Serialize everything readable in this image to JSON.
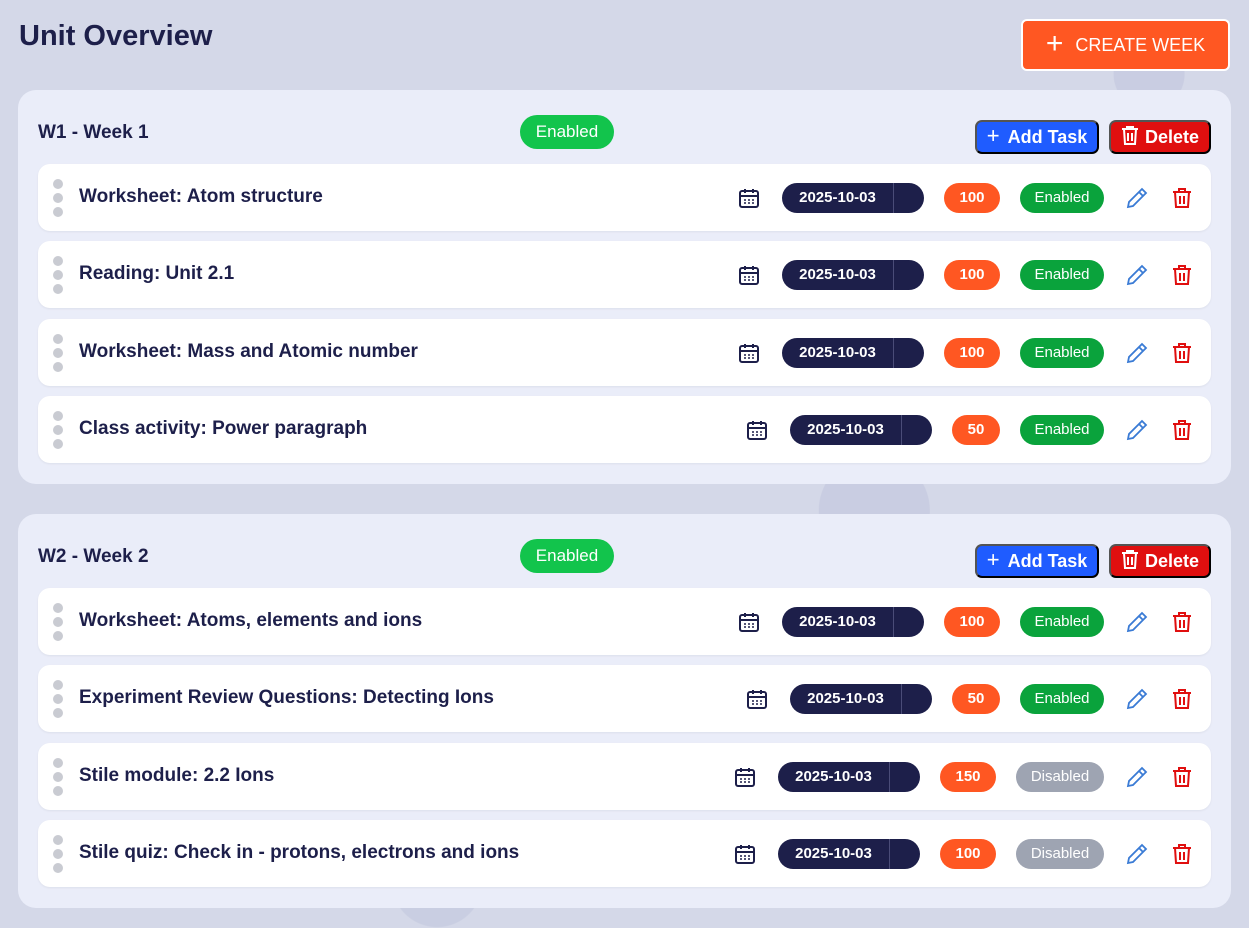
{
  "page": {
    "title": "Unit Overview",
    "create_week_label": "CREATE WEEK"
  },
  "colors": {
    "accent_orange": "#ff5722",
    "primary_blue": "#1f5cff",
    "danger_red": "#e00f0f",
    "enabled_green": "#0aa33c",
    "disabled_gray": "#9ea4b2",
    "navy": "#1d1f4a"
  },
  "icons": {
    "plus": "plus-icon",
    "trash": "trash-icon",
    "calendar": "calendar-icon",
    "edit": "pencil-icon",
    "drag": "drag-handle-icon"
  },
  "weeks": [
    {
      "title": "W1 - Week 1",
      "status": "Enabled",
      "add_task_label": "Add Task",
      "delete_label": "Delete",
      "tasks": [
        {
          "title": "Worksheet: Atom structure",
          "date": "2025-10-03",
          "points": "100",
          "status": "Enabled"
        },
        {
          "title": "Reading: Unit 2.1",
          "date": "2025-10-03",
          "points": "100",
          "status": "Enabled"
        },
        {
          "title": "Worksheet: Mass and Atomic number",
          "date": "2025-10-03",
          "points": "100",
          "status": "Enabled"
        },
        {
          "title": "Class activity: Power paragraph",
          "date": "2025-10-03",
          "points": "50",
          "status": "Enabled"
        }
      ]
    },
    {
      "title": "W2 - Week 2",
      "status": "Enabled",
      "add_task_label": "Add Task",
      "delete_label": "Delete",
      "tasks": [
        {
          "title": "Worksheet: Atoms, elements and ions",
          "date": "2025-10-03",
          "points": "100",
          "status": "Enabled"
        },
        {
          "title": "Experiment Review Questions: Detecting Ions",
          "date": "2025-10-03",
          "points": "50",
          "status": "Enabled"
        },
        {
          "title": "Stile module: 2.2 Ions",
          "date": "2025-10-03",
          "points": "150",
          "status": "Disabled"
        },
        {
          "title": "Stile quiz: Check in - protons, electrons and ions",
          "date": "2025-10-03",
          "points": "100",
          "status": "Disabled"
        }
      ]
    }
  ]
}
